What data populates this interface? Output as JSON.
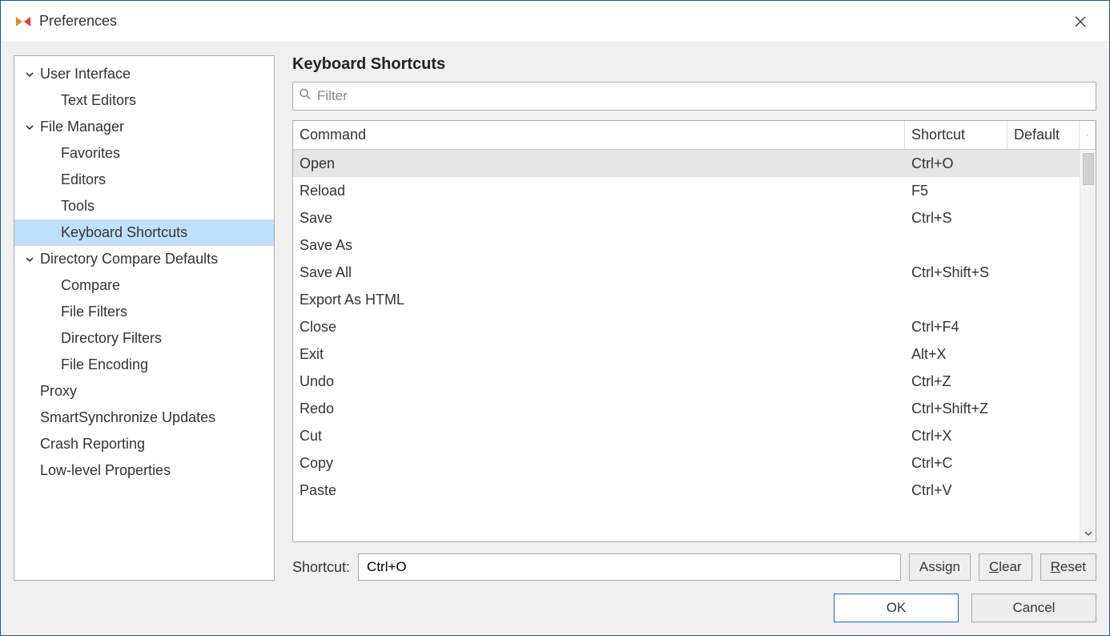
{
  "titlebar": {
    "title": "Preferences"
  },
  "sidebar": {
    "items": [
      {
        "type": "group",
        "label": "User Interface"
      },
      {
        "type": "child",
        "label": "Text Editors"
      },
      {
        "type": "group",
        "label": "File Manager"
      },
      {
        "type": "child",
        "label": "Favorites"
      },
      {
        "type": "child",
        "label": "Editors"
      },
      {
        "type": "child",
        "label": "Tools"
      },
      {
        "type": "child",
        "label": "Keyboard Shortcuts",
        "selected": true
      },
      {
        "type": "group",
        "label": "Directory Compare Defaults"
      },
      {
        "type": "child",
        "label": "Compare"
      },
      {
        "type": "child",
        "label": "File Filters"
      },
      {
        "type": "child",
        "label": "Directory Filters"
      },
      {
        "type": "child",
        "label": "File Encoding"
      },
      {
        "type": "top",
        "label": "Proxy"
      },
      {
        "type": "top",
        "label": "SmartSynchronize Updates"
      },
      {
        "type": "top",
        "label": "Crash Reporting"
      },
      {
        "type": "top",
        "label": "Low-level Properties"
      }
    ]
  },
  "panel": {
    "heading": "Keyboard Shortcuts",
    "filter_placeholder": "Filter",
    "columns": {
      "command": "Command",
      "shortcut": "Shortcut",
      "default": "Default"
    },
    "rows": [
      {
        "command": "Open",
        "shortcut": "Ctrl+O",
        "default": "",
        "selected": true
      },
      {
        "command": "Reload",
        "shortcut": "F5",
        "default": ""
      },
      {
        "command": "Save",
        "shortcut": "Ctrl+S",
        "default": ""
      },
      {
        "command": "Save As",
        "shortcut": "",
        "default": ""
      },
      {
        "command": "Save All",
        "shortcut": "Ctrl+Shift+S",
        "default": ""
      },
      {
        "command": "Export As HTML",
        "shortcut": "",
        "default": ""
      },
      {
        "command": "Close",
        "shortcut": "Ctrl+F4",
        "default": ""
      },
      {
        "command": "Exit",
        "shortcut": "Alt+X",
        "default": ""
      },
      {
        "command": "Undo",
        "shortcut": "Ctrl+Z",
        "default": ""
      },
      {
        "command": "Redo",
        "shortcut": "Ctrl+Shift+Z",
        "default": ""
      },
      {
        "command": "Cut",
        "shortcut": "Ctrl+X",
        "default": ""
      },
      {
        "command": "Copy",
        "shortcut": "Ctrl+C",
        "default": ""
      },
      {
        "command": "Paste",
        "shortcut": "Ctrl+V",
        "default": ""
      }
    ],
    "shortcut_label": "Shortcut:",
    "shortcut_value": "Ctrl+O",
    "buttons": {
      "assign": "Assign",
      "clear": "Clear",
      "reset": "Reset"
    }
  },
  "footer": {
    "ok": "OK",
    "cancel": "Cancel"
  }
}
